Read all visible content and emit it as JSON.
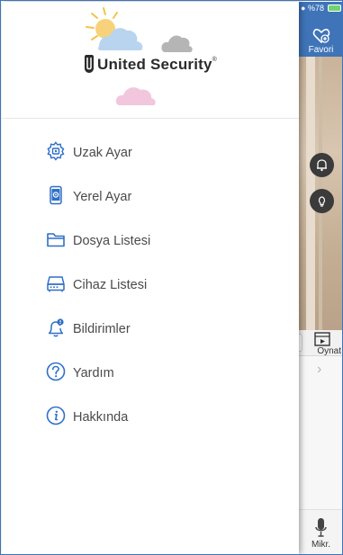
{
  "brand": {
    "name": "United Security",
    "registered_mark": "®"
  },
  "menu": {
    "items": [
      {
        "label": "Uzak Ayar",
        "icon": "remote-settings-gear-icon"
      },
      {
        "label": "Yerel Ayar",
        "icon": "phone-settings-icon"
      },
      {
        "label": "Dosya Listesi",
        "icon": "folder-icon"
      },
      {
        "label": "Cihaz Listesi",
        "icon": "device-recorder-icon"
      },
      {
        "label": "Bildirimler",
        "icon": "bell-notification-icon"
      },
      {
        "label": "Yardım",
        "icon": "help-question-icon"
      },
      {
        "label": "Hakkında",
        "icon": "info-icon"
      }
    ]
  },
  "background_app": {
    "status": {
      "battery": "%78"
    },
    "favorite_label": "Favori",
    "play_label": "Oynat",
    "mic_label": "Mikr."
  },
  "colors": {
    "accent": "#3f74b8",
    "icon_blue": "#2f6fc7",
    "text": "#4a4a4a"
  }
}
